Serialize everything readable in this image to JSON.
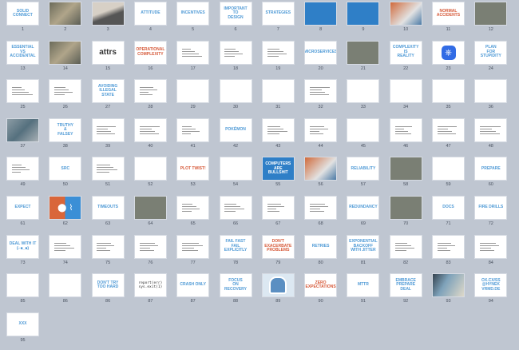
{
  "slides": [
    {
      "n": "1",
      "title": "SOLID CONNECT",
      "style": "text"
    },
    {
      "n": "2",
      "title": "",
      "style": "photo2"
    },
    {
      "n": "3",
      "title": "",
      "style": "photo4"
    },
    {
      "n": "4",
      "title": "ATTITUDE",
      "style": "text"
    },
    {
      "n": "5",
      "title": "INCENTIVES",
      "style": "text"
    },
    {
      "n": "6",
      "title": "IMPORTANT\nTO\nDESIGN",
      "style": "text"
    },
    {
      "n": "7",
      "title": "STRATEGIES",
      "style": "text"
    },
    {
      "n": "8",
      "title": "",
      "style": "blue"
    },
    {
      "n": "9",
      "title": "",
      "style": "blue"
    },
    {
      "n": "10",
      "title": "",
      "style": "photo6"
    },
    {
      "n": "11",
      "title": "NORMAL ACCIDENTS",
      "style": "red"
    },
    {
      "n": "12",
      "title": "",
      "style": "photo"
    },
    {
      "n": "13",
      "title": "ESSENTIAL\nVS\nACCIDENTAL",
      "style": "text"
    },
    {
      "n": "14",
      "title": "",
      "style": "photo2"
    },
    {
      "n": "15",
      "title": "attrs",
      "style": "dark"
    },
    {
      "n": "16",
      "title": "OPERATIONAL\nCOMPLEXITY",
      "style": "red"
    },
    {
      "n": "17",
      "title": "",
      "style": "lines"
    },
    {
      "n": "18",
      "title": "",
      "style": "lines"
    },
    {
      "n": "19",
      "title": "",
      "style": "lines"
    },
    {
      "n": "20",
      "title": "MICROSERVICES",
      "style": "text"
    },
    {
      "n": "21",
      "title": "",
      "style": "photo"
    },
    {
      "n": "22",
      "title": "COMPLEXITY\nIS\nREALITY",
      "style": "text"
    },
    {
      "n": "23",
      "title": "",
      "style": "k8s"
    },
    {
      "n": "24",
      "title": "PLAN\nFOR\nSTUPIDITY",
      "style": "text"
    },
    {
      "n": "25",
      "title": "",
      "style": "lines"
    },
    {
      "n": "26",
      "title": "",
      "style": "lines"
    },
    {
      "n": "27",
      "title": "AVOIDING\nILLEGAL STATE",
      "style": "text"
    },
    {
      "n": "28",
      "title": "",
      "style": "lines"
    },
    {
      "n": "29",
      "title": "",
      "style": "blank"
    },
    {
      "n": "30",
      "title": "",
      "style": "blank"
    },
    {
      "n": "31",
      "title": "",
      "style": "blank"
    },
    {
      "n": "32",
      "title": "",
      "style": "lines"
    },
    {
      "n": "33",
      "title": "",
      "style": "red"
    },
    {
      "n": "34",
      "title": "",
      "style": "blank"
    },
    {
      "n": "35",
      "title": "",
      "style": "blank"
    },
    {
      "n": "36",
      "title": "",
      "style": "blank"
    },
    {
      "n": "37",
      "title": "",
      "style": "photo3"
    },
    {
      "n": "38",
      "title": "TRUTHY\n&\nFALSEY",
      "style": "text"
    },
    {
      "n": "39",
      "title": "",
      "style": "lines"
    },
    {
      "n": "40",
      "title": "",
      "style": "lines"
    },
    {
      "n": "41",
      "title": "",
      "style": "lines"
    },
    {
      "n": "42",
      "title": "POKÉMON",
      "style": "text"
    },
    {
      "n": "43",
      "title": "",
      "style": "lines"
    },
    {
      "n": "44",
      "title": "",
      "style": "lines"
    },
    {
      "n": "45",
      "title": "",
      "style": "faded"
    },
    {
      "n": "46",
      "title": "",
      "style": "lines"
    },
    {
      "n": "47",
      "title": "",
      "style": "lines"
    },
    {
      "n": "48",
      "title": "",
      "style": "lines"
    },
    {
      "n": "49",
      "title": "",
      "style": "lines"
    },
    {
      "n": "50",
      "title": "SRC",
      "style": "text"
    },
    {
      "n": "51",
      "title": "",
      "style": "lines"
    },
    {
      "n": "52",
      "title": "",
      "style": "mono"
    },
    {
      "n": "53",
      "title": "PLOT TWIST!",
      "style": "red"
    },
    {
      "n": "54",
      "title": "",
      "style": "text"
    },
    {
      "n": "55",
      "title": "COMPUTERS ARE\nBULLSHIT",
      "style": "blue"
    },
    {
      "n": "56",
      "title": "",
      "style": "photo6"
    },
    {
      "n": "57",
      "title": "RELIABILITY",
      "style": "text"
    },
    {
      "n": "58",
      "title": "",
      "style": "photo"
    },
    {
      "n": "59",
      "title": "",
      "style": "text"
    },
    {
      "n": "60",
      "title": "PREPARE",
      "style": "text"
    },
    {
      "n": "61",
      "title": "EXPECT",
      "style": "text"
    },
    {
      "n": "62",
      "title": "",
      "style": "orangeblue"
    },
    {
      "n": "63",
      "title": "TIMEOUTS",
      "style": "text"
    },
    {
      "n": "64",
      "title": "",
      "style": "photo"
    },
    {
      "n": "65",
      "title": "",
      "style": "lines"
    },
    {
      "n": "66",
      "title": "",
      "style": "lines"
    },
    {
      "n": "67",
      "title": "",
      "style": "lines"
    },
    {
      "n": "68",
      "title": "",
      "style": "lines"
    },
    {
      "n": "69",
      "title": "REDUNDANCY",
      "style": "text"
    },
    {
      "n": "70",
      "title": "",
      "style": "photo"
    },
    {
      "n": "71",
      "title": "DOCS",
      "style": "text"
    },
    {
      "n": "72",
      "title": "FIRE DRILLS",
      "style": "text"
    },
    {
      "n": "73",
      "title": "DEAL WITH IT\n(⌐■_■)",
      "style": "text"
    },
    {
      "n": "74",
      "title": "",
      "style": "lines"
    },
    {
      "n": "75",
      "title": "",
      "style": "lines"
    },
    {
      "n": "76",
      "title": "",
      "style": "lines"
    },
    {
      "n": "77",
      "title": "",
      "style": "lines"
    },
    {
      "n": "78",
      "title": "FAIL FAST\nFAIL EXPLICITLY",
      "style": "text"
    },
    {
      "n": "79",
      "title": "DON'T\nEXACERBATE\nPROBLEMS",
      "style": "red"
    },
    {
      "n": "80",
      "title": "RETRIES",
      "style": "text"
    },
    {
      "n": "81",
      "title": "EXPONENTIAL\nBACKOFF\nWITH JITTER",
      "style": "text"
    },
    {
      "n": "82",
      "title": "",
      "style": "lines"
    },
    {
      "n": "83",
      "title": "",
      "style": "lines"
    },
    {
      "n": "84",
      "title": "",
      "style": "lines"
    },
    {
      "n": "85",
      "title": "",
      "style": "faded"
    },
    {
      "n": "86",
      "title": "",
      "style": "faded"
    },
    {
      "n": "86",
      "title": "DON'T TRY\nTOO HARD",
      "style": "text"
    },
    {
      "n": "87",
      "title": "report(err)\nsys.exit(1)",
      "style": "mono"
    },
    {
      "n": "87",
      "title": "CRASH ONLY",
      "style": "text"
    },
    {
      "n": "88",
      "title": "FOCUS\nON\nRECOVERY",
      "style": "text"
    },
    {
      "n": "89",
      "title": "",
      "style": "robot"
    },
    {
      "n": "90",
      "title": "ZERO\nEXPECTATIONS",
      "style": "red"
    },
    {
      "n": "91",
      "title": "MTTR",
      "style": "text"
    },
    {
      "n": "92",
      "title": "EMBRACE\nPREPARE\nDEAL",
      "style": "text"
    },
    {
      "n": "93",
      "title": "",
      "style": "photo5"
    },
    {
      "n": "94",
      "title": "OX.CX/SS\n@HYNEK\nVRMD.DE",
      "style": "text"
    },
    {
      "n": "95",
      "title": "XXX",
      "style": "text"
    }
  ]
}
